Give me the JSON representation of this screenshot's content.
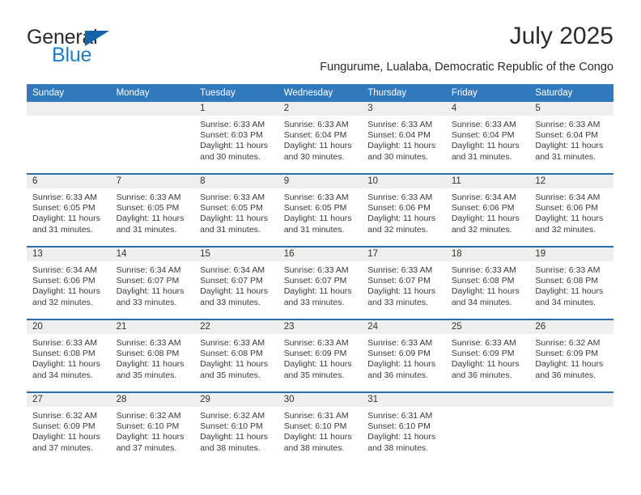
{
  "brand": {
    "name_top": "General",
    "name_bottom": "Blue",
    "accent_color": "#1d7fd1",
    "triangle_color": "#1464ab"
  },
  "header": {
    "title": "July 2025",
    "subtitle": "Fungurume, Lualaba, Democratic Republic of the Congo"
  },
  "theme": {
    "header_blue": "#3179bd",
    "separator_blue": "#2b6cab",
    "daynum_band": "#efefef"
  },
  "calendar": {
    "weekday_headers": [
      "Sunday",
      "Monday",
      "Tuesday",
      "Wednesday",
      "Thursday",
      "Friday",
      "Saturday"
    ],
    "weeks": [
      [
        {
          "day": "",
          "lines": []
        },
        {
          "day": "",
          "lines": []
        },
        {
          "day": "1",
          "lines": [
            "Sunrise: 6:33 AM",
            "Sunset: 6:03 PM",
            "Daylight: 11 hours",
            "and 30 minutes."
          ]
        },
        {
          "day": "2",
          "lines": [
            "Sunrise: 6:33 AM",
            "Sunset: 6:04 PM",
            "Daylight: 11 hours",
            "and 30 minutes."
          ]
        },
        {
          "day": "3",
          "lines": [
            "Sunrise: 6:33 AM",
            "Sunset: 6:04 PM",
            "Daylight: 11 hours",
            "and 30 minutes."
          ]
        },
        {
          "day": "4",
          "lines": [
            "Sunrise: 6:33 AM",
            "Sunset: 6:04 PM",
            "Daylight: 11 hours",
            "and 31 minutes."
          ]
        },
        {
          "day": "5",
          "lines": [
            "Sunrise: 6:33 AM",
            "Sunset: 6:04 PM",
            "Daylight: 11 hours",
            "and 31 minutes."
          ]
        }
      ],
      [
        {
          "day": "6",
          "lines": [
            "Sunrise: 6:33 AM",
            "Sunset: 6:05 PM",
            "Daylight: 11 hours",
            "and 31 minutes."
          ]
        },
        {
          "day": "7",
          "lines": [
            "Sunrise: 6:33 AM",
            "Sunset: 6:05 PM",
            "Daylight: 11 hours",
            "and 31 minutes."
          ]
        },
        {
          "day": "8",
          "lines": [
            "Sunrise: 6:33 AM",
            "Sunset: 6:05 PM",
            "Daylight: 11 hours",
            "and 31 minutes."
          ]
        },
        {
          "day": "9",
          "lines": [
            "Sunrise: 6:33 AM",
            "Sunset: 6:05 PM",
            "Daylight: 11 hours",
            "and 31 minutes."
          ]
        },
        {
          "day": "10",
          "lines": [
            "Sunrise: 6:33 AM",
            "Sunset: 6:06 PM",
            "Daylight: 11 hours",
            "and 32 minutes."
          ]
        },
        {
          "day": "11",
          "lines": [
            "Sunrise: 6:34 AM",
            "Sunset: 6:06 PM",
            "Daylight: 11 hours",
            "and 32 minutes."
          ]
        },
        {
          "day": "12",
          "lines": [
            "Sunrise: 6:34 AM",
            "Sunset: 6:06 PM",
            "Daylight: 11 hours",
            "and 32 minutes."
          ]
        }
      ],
      [
        {
          "day": "13",
          "lines": [
            "Sunrise: 6:34 AM",
            "Sunset: 6:06 PM",
            "Daylight: 11 hours",
            "and 32 minutes."
          ]
        },
        {
          "day": "14",
          "lines": [
            "Sunrise: 6:34 AM",
            "Sunset: 6:07 PM",
            "Daylight: 11 hours",
            "and 33 minutes."
          ]
        },
        {
          "day": "15",
          "lines": [
            "Sunrise: 6:34 AM",
            "Sunset: 6:07 PM",
            "Daylight: 11 hours",
            "and 33 minutes."
          ]
        },
        {
          "day": "16",
          "lines": [
            "Sunrise: 6:33 AM",
            "Sunset: 6:07 PM",
            "Daylight: 11 hours",
            "and 33 minutes."
          ]
        },
        {
          "day": "17",
          "lines": [
            "Sunrise: 6:33 AM",
            "Sunset: 6:07 PM",
            "Daylight: 11 hours",
            "and 33 minutes."
          ]
        },
        {
          "day": "18",
          "lines": [
            "Sunrise: 6:33 AM",
            "Sunset: 6:08 PM",
            "Daylight: 11 hours",
            "and 34 minutes."
          ]
        },
        {
          "day": "19",
          "lines": [
            "Sunrise: 6:33 AM",
            "Sunset: 6:08 PM",
            "Daylight: 11 hours",
            "and 34 minutes."
          ]
        }
      ],
      [
        {
          "day": "20",
          "lines": [
            "Sunrise: 6:33 AM",
            "Sunset: 6:08 PM",
            "Daylight: 11 hours",
            "and 34 minutes."
          ]
        },
        {
          "day": "21",
          "lines": [
            "Sunrise: 6:33 AM",
            "Sunset: 6:08 PM",
            "Daylight: 11 hours",
            "and 35 minutes."
          ]
        },
        {
          "day": "22",
          "lines": [
            "Sunrise: 6:33 AM",
            "Sunset: 6:08 PM",
            "Daylight: 11 hours",
            "and 35 minutes."
          ]
        },
        {
          "day": "23",
          "lines": [
            "Sunrise: 6:33 AM",
            "Sunset: 6:09 PM",
            "Daylight: 11 hours",
            "and 35 minutes."
          ]
        },
        {
          "day": "24",
          "lines": [
            "Sunrise: 6:33 AM",
            "Sunset: 6:09 PM",
            "Daylight: 11 hours",
            "and 36 minutes."
          ]
        },
        {
          "day": "25",
          "lines": [
            "Sunrise: 6:33 AM",
            "Sunset: 6:09 PM",
            "Daylight: 11 hours",
            "and 36 minutes."
          ]
        },
        {
          "day": "26",
          "lines": [
            "Sunrise: 6:32 AM",
            "Sunset: 6:09 PM",
            "Daylight: 11 hours",
            "and 36 minutes."
          ]
        }
      ],
      [
        {
          "day": "27",
          "lines": [
            "Sunrise: 6:32 AM",
            "Sunset: 6:09 PM",
            "Daylight: 11 hours",
            "and 37 minutes."
          ]
        },
        {
          "day": "28",
          "lines": [
            "Sunrise: 6:32 AM",
            "Sunset: 6:10 PM",
            "Daylight: 11 hours",
            "and 37 minutes."
          ]
        },
        {
          "day": "29",
          "lines": [
            "Sunrise: 6:32 AM",
            "Sunset: 6:10 PM",
            "Daylight: 11 hours",
            "and 38 minutes."
          ]
        },
        {
          "day": "30",
          "lines": [
            "Sunrise: 6:31 AM",
            "Sunset: 6:10 PM",
            "Daylight: 11 hours",
            "and 38 minutes."
          ]
        },
        {
          "day": "31",
          "lines": [
            "Sunrise: 6:31 AM",
            "Sunset: 6:10 PM",
            "Daylight: 11 hours",
            "and 38 minutes."
          ]
        },
        {
          "day": "",
          "lines": []
        },
        {
          "day": "",
          "lines": []
        }
      ]
    ]
  }
}
